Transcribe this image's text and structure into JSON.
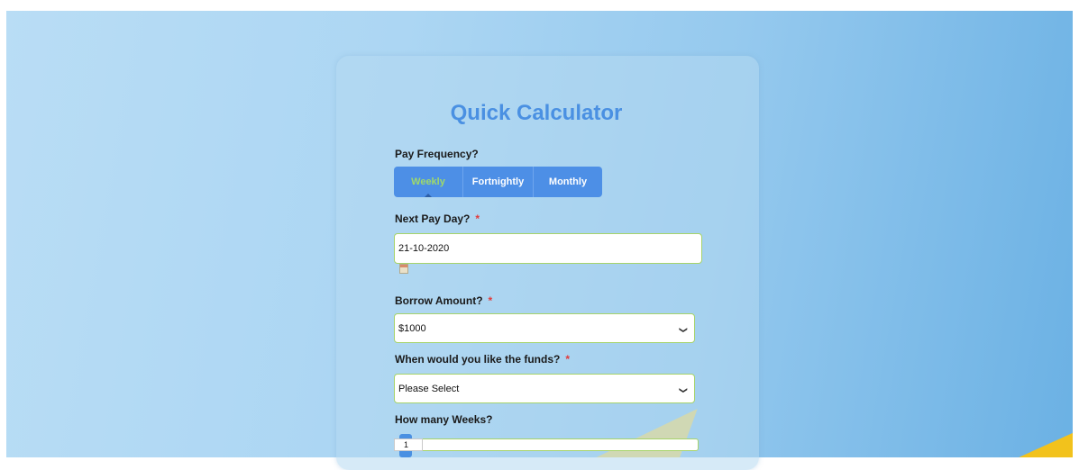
{
  "form": {
    "title": "Quick Calculator",
    "pay_frequency": {
      "label": "Pay Frequency?",
      "options": [
        "Weekly",
        "Fortnightly",
        "Monthly"
      ],
      "selected": "Weekly"
    },
    "next_pay_day": {
      "label": "Next Pay Day?",
      "required_mark": "*",
      "value": "21-10-2020"
    },
    "borrow_amount": {
      "label": "Borrow Amount?",
      "required_mark": "*",
      "value": "$1000"
    },
    "funds_when": {
      "label": "When would you like the funds?",
      "required_mark": "*",
      "value": "Please Select"
    },
    "weeks": {
      "label": "How many Weeks?",
      "value": "1"
    }
  },
  "colors": {
    "accent": "#4a90e2",
    "button": "#4d8fe6",
    "active_text": "#9fd96a",
    "required": "#e23b3b",
    "field_border": "#a6d36a"
  },
  "icons": {
    "calendar": "calendar-icon",
    "dropdown": "chevron-down-icon"
  }
}
